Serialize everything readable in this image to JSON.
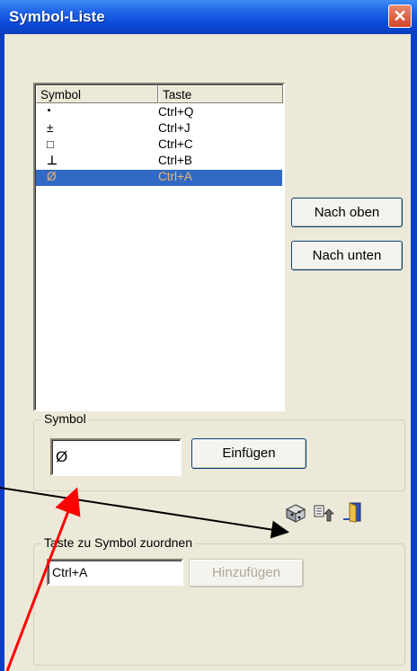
{
  "window": {
    "title": "Symbol-Liste",
    "close_glyph": "✕"
  },
  "list": {
    "headers": [
      "Symbol",
      "Taste"
    ],
    "rows": [
      {
        "symbol": "·",
        "key": "Ctrl+Q"
      },
      {
        "symbol": "±",
        "key": "Ctrl+J"
      },
      {
        "symbol": "□",
        "key": "Ctrl+C"
      },
      {
        "symbol": "⊥",
        "key": "Ctrl+B"
      },
      {
        "symbol": "Ø",
        "key": "Ctrl+A",
        "selected": true
      }
    ]
  },
  "buttons": {
    "move_up": "Nach oben",
    "move_down": "Nach unten",
    "insert": "Einfügen",
    "add": "Hinzufügen"
  },
  "symbol_group": {
    "legend": "Symbol",
    "value": "Ø"
  },
  "key_group": {
    "legend": "Taste zu Symbol zuordnen",
    "value": "Ctrl+A"
  },
  "toolbar_icons": [
    "cube-icon",
    "export-icon",
    "exit-door-icon"
  ],
  "colors": {
    "selection": "#316ac5",
    "annotation_red": "#ff0000",
    "annotation_black": "#000000"
  }
}
